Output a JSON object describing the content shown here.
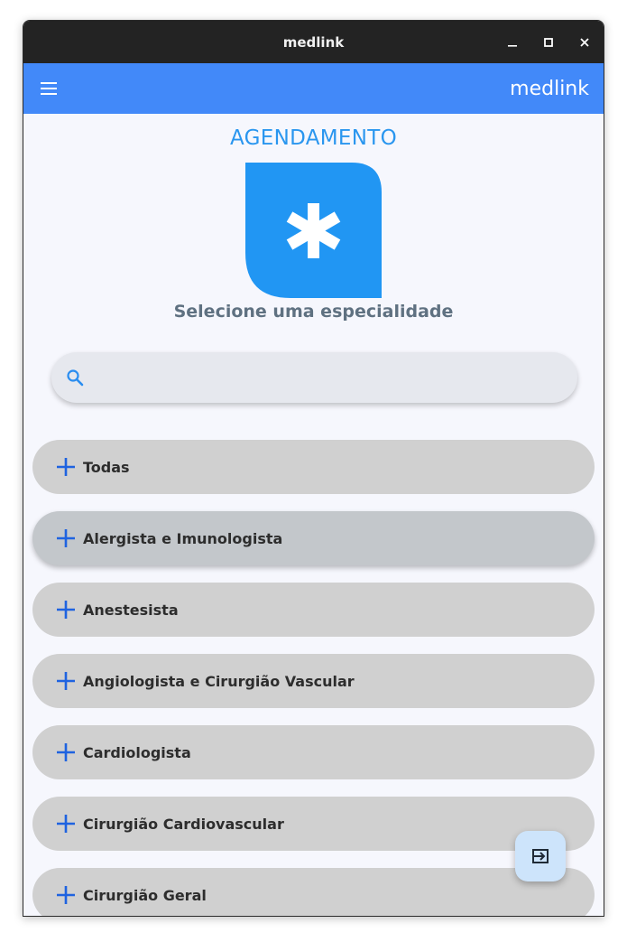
{
  "window": {
    "title": "medlink",
    "controls": [
      "minimize-icon",
      "maximize-icon",
      "close-icon"
    ]
  },
  "appbar": {
    "menu_icon": "hamburger-menu-icon",
    "brand": "medlink",
    "background": "#4289f9"
  },
  "page": {
    "heading": "AGENDAMENTO",
    "logo_icon": "medical-asterisk-icon",
    "subtitle": "Selecione uma especialidade",
    "accent": "#2196f3"
  },
  "search": {
    "icon": "search-icon",
    "value": "",
    "placeholder": ""
  },
  "specialties": [
    {
      "label": "Todas"
    },
    {
      "label": "Alergista e Imunologista"
    },
    {
      "label": "Anestesista"
    },
    {
      "label": "Angiologista e Cirurgião Vascular"
    },
    {
      "label": "Cardiologista"
    },
    {
      "label": "Cirurgião Cardiovascular"
    },
    {
      "label": "Cirurgião Geral"
    }
  ],
  "fab": {
    "icon": "logout-icon"
  }
}
